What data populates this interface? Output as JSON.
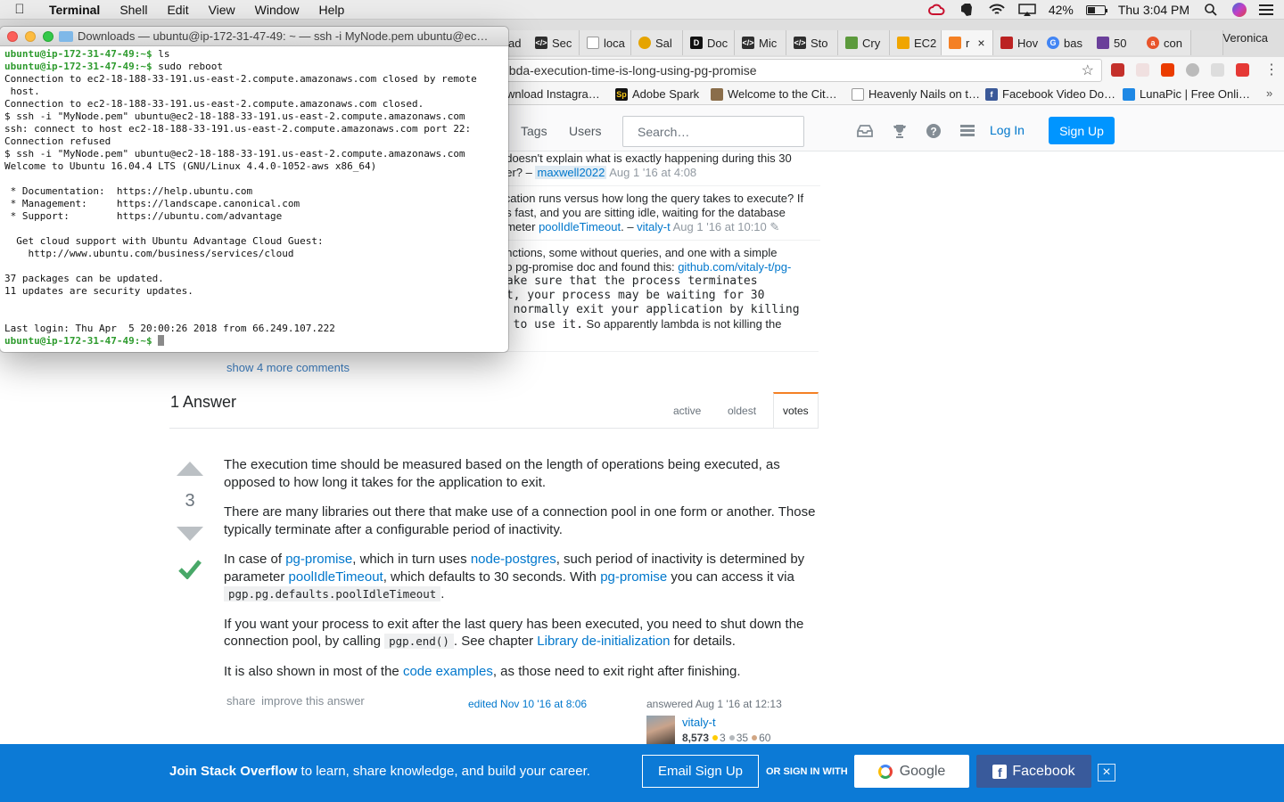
{
  "menubar": {
    "app": "Terminal",
    "items": [
      "Shell",
      "Edit",
      "View",
      "Window",
      "Help"
    ],
    "battery": "42%",
    "clock": "Thu 3:04 PM"
  },
  "browser": {
    "tabs": [
      "ad",
      "Sec",
      "loca",
      "Sal",
      "Doc",
      "Mic",
      "Sto",
      "Cry",
      "EC2",
      "r",
      "Hov",
      "bas",
      "50",
      "con"
    ],
    "profile": "Veronica",
    "url": "nbda-execution-time-is-long-using-pg-promise",
    "bookmarks": [
      "wnload Instagra…",
      "Adobe Spark",
      "Welcome to the Cit…",
      "Heavenly Nails on t…",
      "Facebook Video Do…",
      "LunaPic | Free Onli…"
    ]
  },
  "so": {
    "nav": [
      "Tags",
      "Users"
    ],
    "search_placeholder": "Search…",
    "login": "Log In",
    "signup": "Sign Up",
    "comments": [
      {
        "t1": "t doesn't explain what is exactly happening during this 30",
        "t2a": "ner? – ",
        "user": "maxwell2022",
        "date": "Aug 1 '16 at 4:08"
      },
      {
        "t1": "lication runs versus how long the query takes to execute? If",
        "t2": "ns fast, and you are sitting idle, waiting for the database",
        "t3a": "ameter ",
        "link": "poolIdleTimeout",
        "t3b": ". – ",
        "user": "vitaly-t",
        "date": "Aug 1 '16 at 10:10"
      },
      {
        "t1": "unctions, some without queries, and one with a simple",
        "t2a": "up pg-promise doc and found this: ",
        "link": "github.com/vitaly-t/pg-",
        "code1": "make sure that the process terminates",
        "code2": "it, your process may be waiting for 30",
        "code3": "u normally exit your application by killing",
        "code4a": "d to use it.",
        "t4b": " So apparently lambda is not killing the"
      }
    ],
    "show_more": "show 4 more comments",
    "answers_count": "1 Answer",
    "sort_tabs": [
      "active",
      "oldest",
      "votes"
    ],
    "vote_count": "3",
    "answer": {
      "p1": "The execution time should be measured based on the length of operations being executed, as opposed to how long it takes for the application to exit.",
      "p2": "There are many libraries out there that make use of a connection pool in one form or another. Those typically terminate after a configurable period of inactivity.",
      "p3a": "In case of ",
      "p3_link1": "pg-promise",
      "p3b": ", which in turn uses ",
      "p3_link2": "node-postgres",
      "p3c": ", such period of inactivity is determined by parameter ",
      "p3_link3": "poolIdleTimeout",
      "p3d": ", which defaults to 30 seconds. With ",
      "p3_link4": "pg-promise",
      "p3e": " you can access it via ",
      "p3_code": "pgp.pg.defaults.poolIdleTimeout",
      "p3f": ".",
      "p4a": "If you want your process to exit after the last query has been executed, you need to shut down the connection pool, by calling ",
      "p4_code": "pgp.end()",
      "p4b": ". See chapter ",
      "p4_link": "Library de-initialization",
      "p4c": " for details.",
      "p5a": "It is also shown in most of the ",
      "p5_link": "code examples",
      "p5b": ", as those need to exit right after finishing."
    },
    "post_menu": [
      "share",
      "improve this answer"
    ],
    "edited": "edited Nov 10 '16 at 8:06",
    "answered": "answered Aug 1 '16 at 12:13",
    "author": "vitaly-t",
    "reputation": "8,573",
    "gold": "3",
    "silver": "35",
    "bronze": "60",
    "banner": {
      "join_bold": "Join Stack Overflow",
      "join_rest": " to learn, share knowledge, and build your career.",
      "email": "Email Sign Up",
      "or": "OR SIGN IN WITH",
      "google": "Google",
      "facebook": "Facebook"
    }
  },
  "terminal": {
    "title": "Downloads — ubuntu@ip-172-31-47-49: ~ — ssh -i MyNode.pem ubuntu@ec…",
    "prompt": "ubuntu@ip-172-31-47-49:~$",
    "lines": [
      {
        "p": true,
        "t": " ls"
      },
      {
        "p": true,
        "t": " sudo reboot"
      },
      {
        "t": "Connection to ec2-18-188-33-191.us-east-2.compute.amazonaws.com closed by remote"
      },
      {
        "t": " host."
      },
      {
        "t": "Connection to ec2-18-188-33-191.us-east-2.compute.amazonaws.com closed."
      },
      {
        "t": "$ ssh -i \"MyNode.pem\" ubuntu@ec2-18-188-33-191.us-east-2.compute.amazonaws.com"
      },
      {
        "t": "ssh: connect to host ec2-18-188-33-191.us-east-2.compute.amazonaws.com port 22:"
      },
      {
        "t": "Connection refused"
      },
      {
        "t": "$ ssh -i \"MyNode.pem\" ubuntu@ec2-18-188-33-191.us-east-2.compute.amazonaws.com"
      },
      {
        "t": "Welcome to Ubuntu 16.04.4 LTS (GNU/Linux 4.4.0-1052-aws x86_64)"
      },
      {
        "t": ""
      },
      {
        "t": " * Documentation:  https://help.ubuntu.com"
      },
      {
        "t": " * Management:     https://landscape.canonical.com"
      },
      {
        "t": " * Support:        https://ubuntu.com/advantage"
      },
      {
        "t": ""
      },
      {
        "t": "  Get cloud support with Ubuntu Advantage Cloud Guest:"
      },
      {
        "t": "    http://www.ubuntu.com/business/services/cloud"
      },
      {
        "t": ""
      },
      {
        "t": "37 packages can be updated."
      },
      {
        "t": "11 updates are security updates."
      },
      {
        "t": ""
      },
      {
        "t": ""
      },
      {
        "t": "Last login: Thu Apr  5 20:00:26 2018 from 66.249.107.222"
      },
      {
        "p": true,
        "t": " ",
        "cursor": true
      }
    ]
  }
}
